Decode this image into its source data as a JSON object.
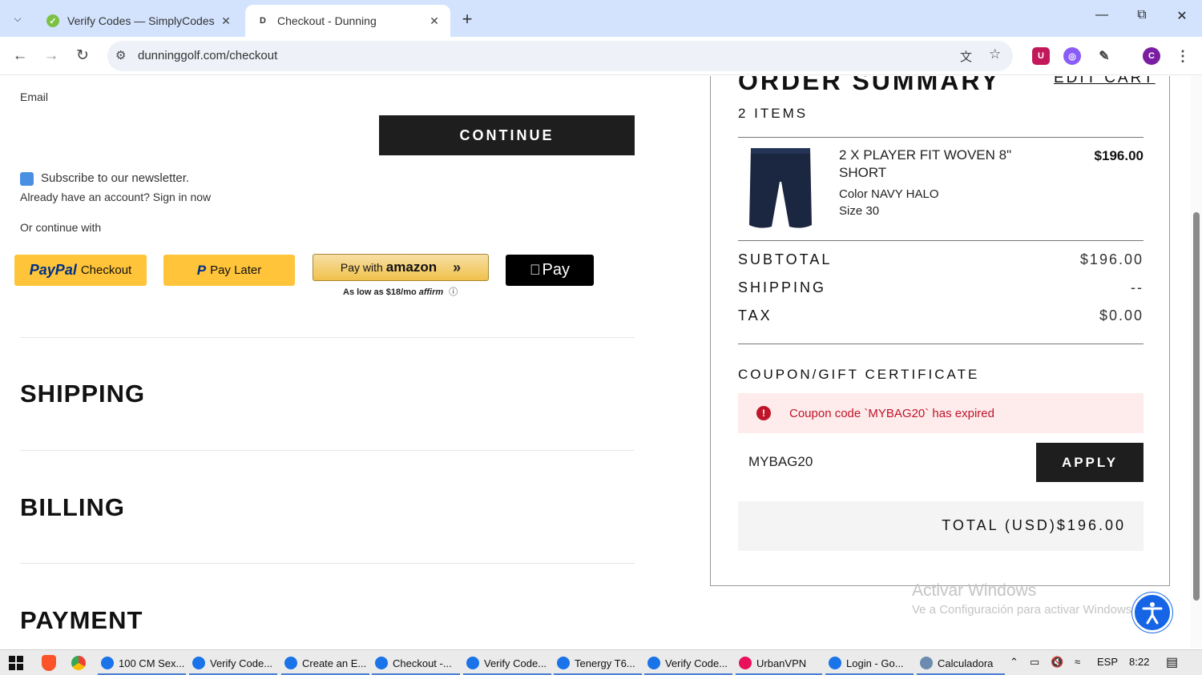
{
  "browser": {
    "tabs": [
      {
        "title": "Verify Codes — SimplyCodes",
        "active": false
      },
      {
        "title": "Checkout - Dunning",
        "active": true
      }
    ],
    "url": "dunninggolf.com/checkout",
    "profile_initial": "C"
  },
  "checkout": {
    "email_label": "Email",
    "continue_label": "CONTINUE",
    "newsletter_label": "Subscribe to our newsletter.",
    "signin_text": "Already have an account? Sign in now",
    "or_continue_with": "Or continue with",
    "paypal": {
      "brand": "PayPal",
      "label": "Checkout"
    },
    "paylater": {
      "label": "Pay Later"
    },
    "amazon": {
      "label": "Pay with",
      "brand": "amazon",
      "subtext": "As low as $18/mo",
      "affirm": "affirm"
    },
    "applepay": {
      "label": "Pay"
    },
    "sections": [
      "SHIPPING",
      "BILLING",
      "PAYMENT"
    ]
  },
  "summary": {
    "title": "ORDER SUMMARY",
    "edit_cart": "EDIT CART",
    "items_count": "2 ITEMS",
    "item": {
      "name": "2 X PLAYER FIT WOVEN 8\" SHORT",
      "price": "$196.00",
      "color": "Color NAVY HALO",
      "size": "Size 30"
    },
    "subtotal_label": "SUBTOTAL",
    "subtotal_value": "$196.00",
    "shipping_label": "SHIPPING",
    "shipping_value": "--",
    "tax_label": "TAX",
    "tax_value": "$0.00",
    "coupon_title": "COUPON/GIFT CERTIFICATE",
    "coupon_error": "Coupon code `MYBAG20` has expired",
    "coupon_value": "MYBAG20",
    "apply_label": "APPLY",
    "total_label": "TOTAL (USD)",
    "total_value": "$196.00"
  },
  "watermark": {
    "line1": "Activar Windows",
    "line2": "Ve a Configuración para activar Windows."
  },
  "taskbar": {
    "items": [
      {
        "label": "100 CM Sex...",
        "color": "#1a73e8"
      },
      {
        "label": "Verify Code...",
        "color": "#1a73e8"
      },
      {
        "label": "Create an E...",
        "color": "#1a73e8"
      },
      {
        "label": "Checkout -...",
        "color": "#1a73e8"
      },
      {
        "label": "Verify Code...",
        "color": "#1a73e8"
      },
      {
        "label": "Tenergy T6...",
        "color": "#1a73e8"
      },
      {
        "label": "Verify Code...",
        "color": "#1a73e8"
      },
      {
        "label": "UrbanVPN",
        "color": "#e8125c"
      },
      {
        "label": "Login - Go...",
        "color": "#1a73e8"
      },
      {
        "label": "Calculadora",
        "color": "#6b8cae"
      }
    ],
    "language": "ESP",
    "time": "8:22"
  }
}
